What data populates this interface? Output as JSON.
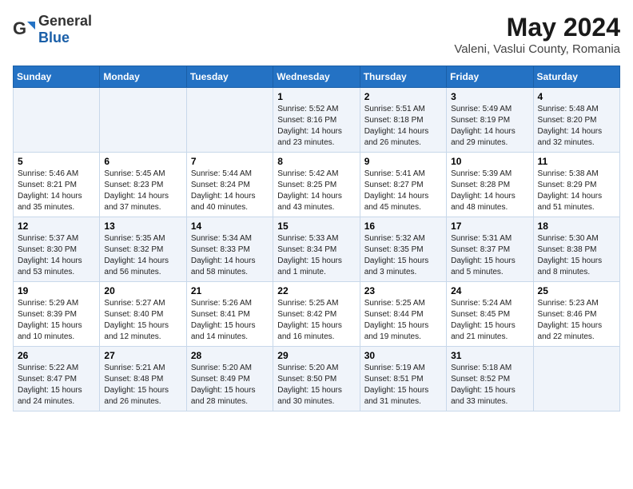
{
  "logo": {
    "general": "General",
    "blue": "Blue"
  },
  "title": "May 2024",
  "subtitle": "Valeni, Vaslui County, Romania",
  "days_of_week": [
    "Sunday",
    "Monday",
    "Tuesday",
    "Wednesday",
    "Thursday",
    "Friday",
    "Saturday"
  ],
  "weeks": [
    [
      {
        "day": "",
        "info": ""
      },
      {
        "day": "",
        "info": ""
      },
      {
        "day": "",
        "info": ""
      },
      {
        "day": "1",
        "info": "Sunrise: 5:52 AM\nSunset: 8:16 PM\nDaylight: 14 hours and 23 minutes."
      },
      {
        "day": "2",
        "info": "Sunrise: 5:51 AM\nSunset: 8:18 PM\nDaylight: 14 hours and 26 minutes."
      },
      {
        "day": "3",
        "info": "Sunrise: 5:49 AM\nSunset: 8:19 PM\nDaylight: 14 hours and 29 minutes."
      },
      {
        "day": "4",
        "info": "Sunrise: 5:48 AM\nSunset: 8:20 PM\nDaylight: 14 hours and 32 minutes."
      }
    ],
    [
      {
        "day": "5",
        "info": "Sunrise: 5:46 AM\nSunset: 8:21 PM\nDaylight: 14 hours and 35 minutes."
      },
      {
        "day": "6",
        "info": "Sunrise: 5:45 AM\nSunset: 8:23 PM\nDaylight: 14 hours and 37 minutes."
      },
      {
        "day": "7",
        "info": "Sunrise: 5:44 AM\nSunset: 8:24 PM\nDaylight: 14 hours and 40 minutes."
      },
      {
        "day": "8",
        "info": "Sunrise: 5:42 AM\nSunset: 8:25 PM\nDaylight: 14 hours and 43 minutes."
      },
      {
        "day": "9",
        "info": "Sunrise: 5:41 AM\nSunset: 8:27 PM\nDaylight: 14 hours and 45 minutes."
      },
      {
        "day": "10",
        "info": "Sunrise: 5:39 AM\nSunset: 8:28 PM\nDaylight: 14 hours and 48 minutes."
      },
      {
        "day": "11",
        "info": "Sunrise: 5:38 AM\nSunset: 8:29 PM\nDaylight: 14 hours and 51 minutes."
      }
    ],
    [
      {
        "day": "12",
        "info": "Sunrise: 5:37 AM\nSunset: 8:30 PM\nDaylight: 14 hours and 53 minutes."
      },
      {
        "day": "13",
        "info": "Sunrise: 5:35 AM\nSunset: 8:32 PM\nDaylight: 14 hours and 56 minutes."
      },
      {
        "day": "14",
        "info": "Sunrise: 5:34 AM\nSunset: 8:33 PM\nDaylight: 14 hours and 58 minutes."
      },
      {
        "day": "15",
        "info": "Sunrise: 5:33 AM\nSunset: 8:34 PM\nDaylight: 15 hours and 1 minute."
      },
      {
        "day": "16",
        "info": "Sunrise: 5:32 AM\nSunset: 8:35 PM\nDaylight: 15 hours and 3 minutes."
      },
      {
        "day": "17",
        "info": "Sunrise: 5:31 AM\nSunset: 8:37 PM\nDaylight: 15 hours and 5 minutes."
      },
      {
        "day": "18",
        "info": "Sunrise: 5:30 AM\nSunset: 8:38 PM\nDaylight: 15 hours and 8 minutes."
      }
    ],
    [
      {
        "day": "19",
        "info": "Sunrise: 5:29 AM\nSunset: 8:39 PM\nDaylight: 15 hours and 10 minutes."
      },
      {
        "day": "20",
        "info": "Sunrise: 5:27 AM\nSunset: 8:40 PM\nDaylight: 15 hours and 12 minutes."
      },
      {
        "day": "21",
        "info": "Sunrise: 5:26 AM\nSunset: 8:41 PM\nDaylight: 15 hours and 14 minutes."
      },
      {
        "day": "22",
        "info": "Sunrise: 5:25 AM\nSunset: 8:42 PM\nDaylight: 15 hours and 16 minutes."
      },
      {
        "day": "23",
        "info": "Sunrise: 5:25 AM\nSunset: 8:44 PM\nDaylight: 15 hours and 19 minutes."
      },
      {
        "day": "24",
        "info": "Sunrise: 5:24 AM\nSunset: 8:45 PM\nDaylight: 15 hours and 21 minutes."
      },
      {
        "day": "25",
        "info": "Sunrise: 5:23 AM\nSunset: 8:46 PM\nDaylight: 15 hours and 22 minutes."
      }
    ],
    [
      {
        "day": "26",
        "info": "Sunrise: 5:22 AM\nSunset: 8:47 PM\nDaylight: 15 hours and 24 minutes."
      },
      {
        "day": "27",
        "info": "Sunrise: 5:21 AM\nSunset: 8:48 PM\nDaylight: 15 hours and 26 minutes."
      },
      {
        "day": "28",
        "info": "Sunrise: 5:20 AM\nSunset: 8:49 PM\nDaylight: 15 hours and 28 minutes."
      },
      {
        "day": "29",
        "info": "Sunrise: 5:20 AM\nSunset: 8:50 PM\nDaylight: 15 hours and 30 minutes."
      },
      {
        "day": "30",
        "info": "Sunrise: 5:19 AM\nSunset: 8:51 PM\nDaylight: 15 hours and 31 minutes."
      },
      {
        "day": "31",
        "info": "Sunrise: 5:18 AM\nSunset: 8:52 PM\nDaylight: 15 hours and 33 minutes."
      },
      {
        "day": "",
        "info": ""
      }
    ]
  ]
}
